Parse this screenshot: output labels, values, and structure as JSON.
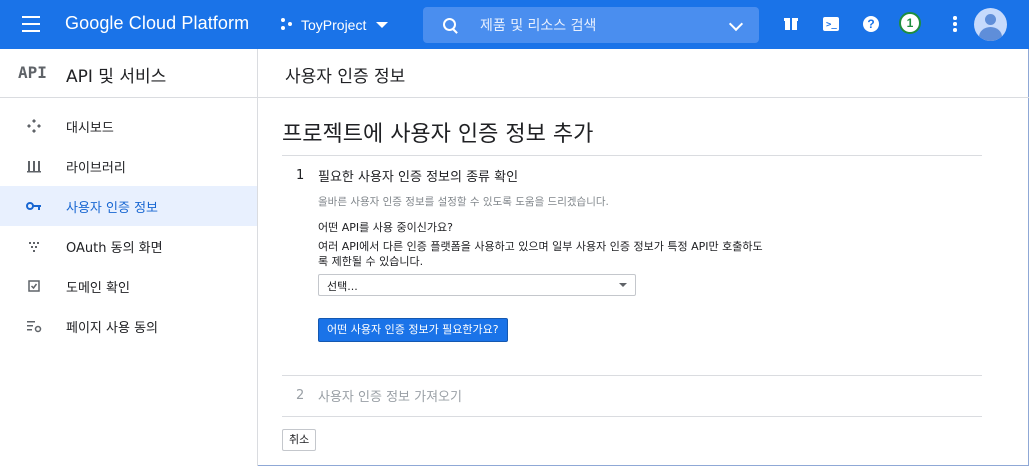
{
  "topbar": {
    "brand": "Google Cloud Platform",
    "project": "ToyProject",
    "search_placeholder": "제품 및 리소스 검색",
    "notification_count": "1"
  },
  "leftnav": {
    "logo": "API",
    "title": "API 및 서비스",
    "items": [
      {
        "label": "대시보드",
        "icon": "dashboard-icon"
      },
      {
        "label": "라이브러리",
        "icon": "library-icon"
      },
      {
        "label": "사용자 인증 정보",
        "icon": "key-icon",
        "active": true
      },
      {
        "label": "OAuth 동의 화면",
        "icon": "oauth-consent-icon"
      },
      {
        "label": "도메인 확인",
        "icon": "domain-check-icon"
      },
      {
        "label": "페이지 사용 동의",
        "icon": "page-usage-icon"
      }
    ]
  },
  "header": {
    "title": "사용자 인증 정보"
  },
  "main": {
    "heading": "프로젝트에 사용자 인증 정보 추가",
    "step1": {
      "number": "1",
      "title": "필요한 사용자 인증 정보의 종류 확인",
      "subtitle": "올바른 사용자 인증 정보를 설정할 수 있도록 도움을 드리겠습니다.",
      "question": "어떤 API를 사용 중이신가요?",
      "description": "여러 API에서 다른 인증 플랫폼을 사용하고 있으며 일부 사용자 인증 정보가 특정 API만 호출하도록 제한될 수 있습니다.",
      "select_value": "선택...",
      "button_label": "어떤 사용자 인증 정보가 필요한가요?"
    },
    "step2": {
      "number": "2",
      "title": "사용자 인증 정보 가져오기"
    },
    "cancel_label": "취소"
  },
  "colors": {
    "brand_blue": "#1a73e8",
    "active_nav_bg": "#e8f0fe",
    "notif_green": "#1e8e3e"
  }
}
